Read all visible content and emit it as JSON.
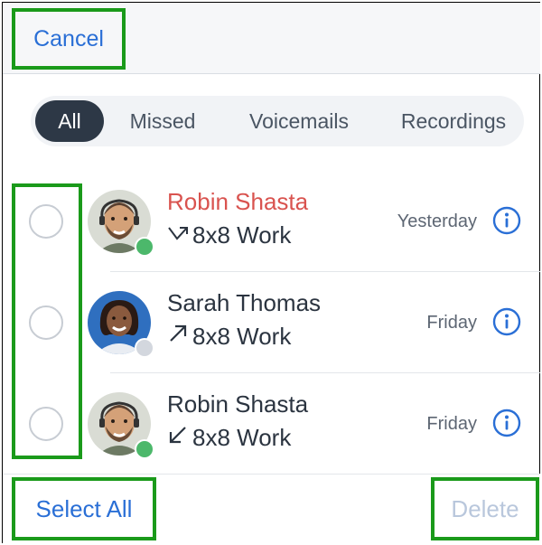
{
  "header": {
    "cancel_label": "Cancel"
  },
  "filters": {
    "tabs": [
      {
        "label": "All",
        "active": true
      },
      {
        "label": "Missed",
        "active": false
      },
      {
        "label": "Voicemails",
        "active": false
      },
      {
        "label": "Recordings",
        "active": false
      }
    ]
  },
  "calls": [
    {
      "name": "Robin Shasta",
      "missed": true,
      "direction_icon": "missed-call-arrow-icon",
      "direction_glyph": "↗",
      "line": "8x8 Work",
      "date": "Yesterday",
      "presence": "available"
    },
    {
      "name": "Sarah Thomas",
      "missed": false,
      "direction_icon": "outgoing-call-arrow-icon",
      "direction_glyph": "↗",
      "line": "8x8 Work",
      "date": "Friday",
      "presence": "offline"
    },
    {
      "name": "Robin Shasta",
      "missed": false,
      "direction_icon": "incoming-call-arrow-icon",
      "direction_glyph": "↙",
      "line": "8x8 Work",
      "date": "Friday",
      "presence": "available"
    }
  ],
  "footer": {
    "select_all_label": "Select All",
    "delete_label": "Delete"
  },
  "colors": {
    "accent": "#2a6fd6",
    "missed_name": "#d9534f",
    "presence_available": "#4cb86b",
    "presence_offline": "#d3d7de",
    "active_tab_bg": "#2d3846",
    "highlight_border": "#1a9a1a"
  }
}
